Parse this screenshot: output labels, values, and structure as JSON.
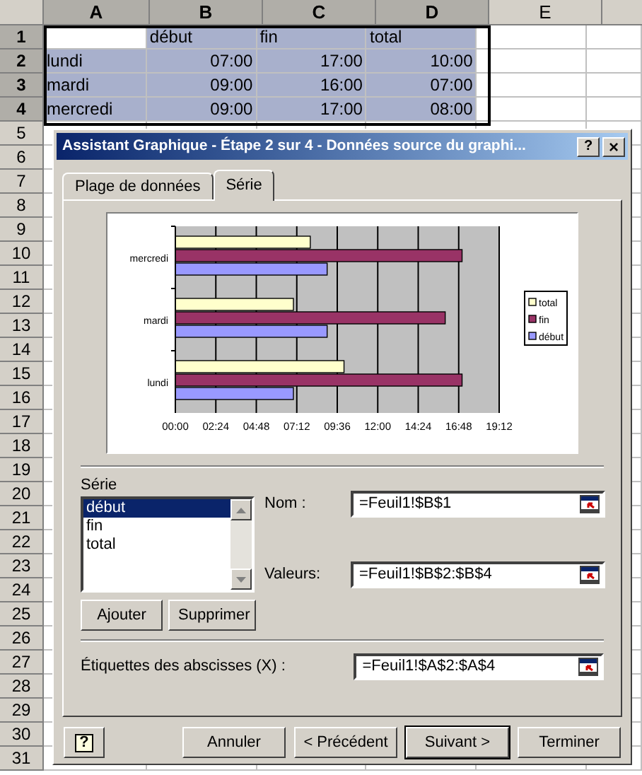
{
  "sheet": {
    "columns": [
      "A",
      "B",
      "C",
      "D",
      "E"
    ],
    "header_row": {
      "number": "1",
      "cells": [
        "début",
        "fin",
        "total"
      ]
    },
    "rows": [
      {
        "number": "2",
        "label": "lundi",
        "values": [
          "07:00",
          "17:00",
          "10:00"
        ]
      },
      {
        "number": "3",
        "label": "mardi",
        "values": [
          "09:00",
          "16:00",
          "07:00"
        ]
      },
      {
        "number": "4",
        "label": "mercredi",
        "values": [
          "09:00",
          "17:00",
          "08:00"
        ]
      }
    ],
    "more_row_numbers": [
      "5",
      "6",
      "7",
      "8",
      "9",
      "10",
      "11",
      "12",
      "13",
      "14",
      "15",
      "16",
      "17",
      "18",
      "19",
      "20",
      "21",
      "22",
      "23",
      "24",
      "25",
      "26",
      "27",
      "28",
      "29",
      "30",
      "31"
    ]
  },
  "dialog": {
    "title": "Assistant Graphique - Étape 2 sur 4 - Données source du graphi...",
    "help_button": "?",
    "close_button": "×",
    "tabs": [
      {
        "label": "Plage de données",
        "selected": false
      },
      {
        "label": "Série",
        "selected": true
      }
    ],
    "chart_data": {
      "type": "bar",
      "orientation": "horizontal",
      "grid": true,
      "legend": true,
      "categories": [
        "mercredi",
        "mardi",
        "lundi"
      ],
      "series": [
        {
          "name": "début",
          "color": "#9999ff",
          "values": [
            9,
            9,
            7
          ]
        },
        {
          "name": "fin",
          "color": "#993366",
          "values": [
            17,
            16,
            17
          ]
        },
        {
          "name": "total",
          "color": "#ffffcc",
          "values": [
            8,
            7,
            10
          ]
        }
      ],
      "xlim": [
        0,
        19.2
      ],
      "xticks": [
        {
          "value": 0,
          "label": "00:00"
        },
        {
          "value": 2.4,
          "label": "02:24"
        },
        {
          "value": 4.8,
          "label": "04:48"
        },
        {
          "value": 7.2,
          "label": "07:12"
        },
        {
          "value": 9.6,
          "label": "09:36"
        },
        {
          "value": 12,
          "label": "12:00"
        },
        {
          "value": 14.4,
          "label": "14:24"
        },
        {
          "value": 16.8,
          "label": "16:48"
        },
        {
          "value": 19.2,
          "label": "19:12"
        }
      ]
    },
    "series_list": {
      "label": "Série",
      "items": [
        {
          "label": "début",
          "selected": true
        },
        {
          "label": "fin",
          "selected": false
        },
        {
          "label": "total",
          "selected": false
        }
      ]
    },
    "list_buttons": [
      "Ajouter",
      "Supprimer"
    ],
    "name_field": {
      "label": "Nom :",
      "value": "=Feuil1!$B$1"
    },
    "values_field": {
      "label": "Valeurs:",
      "value": "=Feuil1!$B$2:$B$4"
    },
    "x_labels_field": {
      "label": "Étiquettes des abscisses (X) :",
      "value": "=Feuil1!$A$2:$A$4"
    },
    "footer_help": "?",
    "footer_buttons": [
      {
        "label": "Annuler",
        "default": false
      },
      {
        "label": "< Précédent",
        "default": false
      },
      {
        "label": "Suivant >",
        "default": true
      },
      {
        "label": "Terminer",
        "default": false
      }
    ]
  }
}
